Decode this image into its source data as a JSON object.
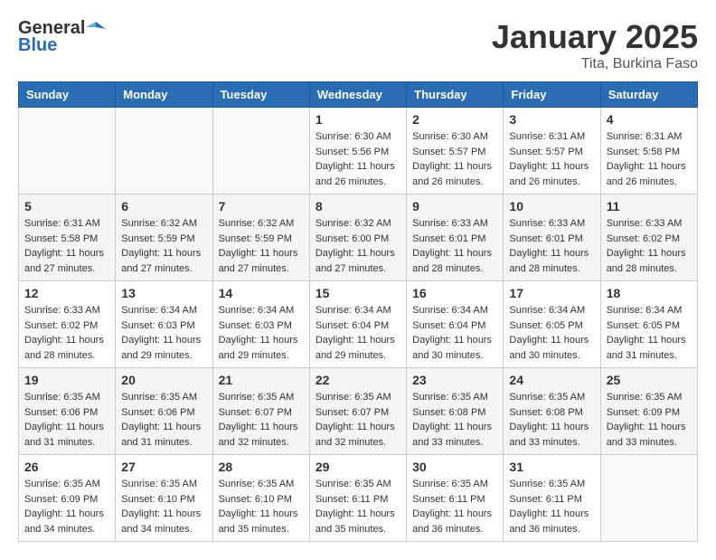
{
  "logo": {
    "general": "General",
    "blue": "Blue"
  },
  "header": {
    "month": "January 2025",
    "location": "Tita, Burkina Faso"
  },
  "weekdays": [
    "Sunday",
    "Monday",
    "Tuesday",
    "Wednesday",
    "Thursday",
    "Friday",
    "Saturday"
  ],
  "weeks": [
    [
      {
        "day": "",
        "info": []
      },
      {
        "day": "",
        "info": []
      },
      {
        "day": "",
        "info": []
      },
      {
        "day": "1",
        "info": [
          "Sunrise: 6:30 AM",
          "Sunset: 5:56 PM",
          "Daylight: 11 hours and 26 minutes."
        ]
      },
      {
        "day": "2",
        "info": [
          "Sunrise: 6:30 AM",
          "Sunset: 5:57 PM",
          "Daylight: 11 hours and 26 minutes."
        ]
      },
      {
        "day": "3",
        "info": [
          "Sunrise: 6:31 AM",
          "Sunset: 5:57 PM",
          "Daylight: 11 hours and 26 minutes."
        ]
      },
      {
        "day": "4",
        "info": [
          "Sunrise: 6:31 AM",
          "Sunset: 5:58 PM",
          "Daylight: 11 hours and 26 minutes."
        ]
      }
    ],
    [
      {
        "day": "5",
        "info": [
          "Sunrise: 6:31 AM",
          "Sunset: 5:58 PM",
          "Daylight: 11 hours and 27 minutes."
        ]
      },
      {
        "day": "6",
        "info": [
          "Sunrise: 6:32 AM",
          "Sunset: 5:59 PM",
          "Daylight: 11 hours and 27 minutes."
        ]
      },
      {
        "day": "7",
        "info": [
          "Sunrise: 6:32 AM",
          "Sunset: 5:59 PM",
          "Daylight: 11 hours and 27 minutes."
        ]
      },
      {
        "day": "8",
        "info": [
          "Sunrise: 6:32 AM",
          "Sunset: 6:00 PM",
          "Daylight: 11 hours and 27 minutes."
        ]
      },
      {
        "day": "9",
        "info": [
          "Sunrise: 6:33 AM",
          "Sunset: 6:01 PM",
          "Daylight: 11 hours and 28 minutes."
        ]
      },
      {
        "day": "10",
        "info": [
          "Sunrise: 6:33 AM",
          "Sunset: 6:01 PM",
          "Daylight: 11 hours and 28 minutes."
        ]
      },
      {
        "day": "11",
        "info": [
          "Sunrise: 6:33 AM",
          "Sunset: 6:02 PM",
          "Daylight: 11 hours and 28 minutes."
        ]
      }
    ],
    [
      {
        "day": "12",
        "info": [
          "Sunrise: 6:33 AM",
          "Sunset: 6:02 PM",
          "Daylight: 11 hours and 28 minutes."
        ]
      },
      {
        "day": "13",
        "info": [
          "Sunrise: 6:34 AM",
          "Sunset: 6:03 PM",
          "Daylight: 11 hours and 29 minutes."
        ]
      },
      {
        "day": "14",
        "info": [
          "Sunrise: 6:34 AM",
          "Sunset: 6:03 PM",
          "Daylight: 11 hours and 29 minutes."
        ]
      },
      {
        "day": "15",
        "info": [
          "Sunrise: 6:34 AM",
          "Sunset: 6:04 PM",
          "Daylight: 11 hours and 29 minutes."
        ]
      },
      {
        "day": "16",
        "info": [
          "Sunrise: 6:34 AM",
          "Sunset: 6:04 PM",
          "Daylight: 11 hours and 30 minutes."
        ]
      },
      {
        "day": "17",
        "info": [
          "Sunrise: 6:34 AM",
          "Sunset: 6:05 PM",
          "Daylight: 11 hours and 30 minutes."
        ]
      },
      {
        "day": "18",
        "info": [
          "Sunrise: 6:34 AM",
          "Sunset: 6:05 PM",
          "Daylight: 11 hours and 31 minutes."
        ]
      }
    ],
    [
      {
        "day": "19",
        "info": [
          "Sunrise: 6:35 AM",
          "Sunset: 6:06 PM",
          "Daylight: 11 hours and 31 minutes."
        ]
      },
      {
        "day": "20",
        "info": [
          "Sunrise: 6:35 AM",
          "Sunset: 6:06 PM",
          "Daylight: 11 hours and 31 minutes."
        ]
      },
      {
        "day": "21",
        "info": [
          "Sunrise: 6:35 AM",
          "Sunset: 6:07 PM",
          "Daylight: 11 hours and 32 minutes."
        ]
      },
      {
        "day": "22",
        "info": [
          "Sunrise: 6:35 AM",
          "Sunset: 6:07 PM",
          "Daylight: 11 hours and 32 minutes."
        ]
      },
      {
        "day": "23",
        "info": [
          "Sunrise: 6:35 AM",
          "Sunset: 6:08 PM",
          "Daylight: 11 hours and 33 minutes."
        ]
      },
      {
        "day": "24",
        "info": [
          "Sunrise: 6:35 AM",
          "Sunset: 6:08 PM",
          "Daylight: 11 hours and 33 minutes."
        ]
      },
      {
        "day": "25",
        "info": [
          "Sunrise: 6:35 AM",
          "Sunset: 6:09 PM",
          "Daylight: 11 hours and 33 minutes."
        ]
      }
    ],
    [
      {
        "day": "26",
        "info": [
          "Sunrise: 6:35 AM",
          "Sunset: 6:09 PM",
          "Daylight: 11 hours and 34 minutes."
        ]
      },
      {
        "day": "27",
        "info": [
          "Sunrise: 6:35 AM",
          "Sunset: 6:10 PM",
          "Daylight: 11 hours and 34 minutes."
        ]
      },
      {
        "day": "28",
        "info": [
          "Sunrise: 6:35 AM",
          "Sunset: 6:10 PM",
          "Daylight: 11 hours and 35 minutes."
        ]
      },
      {
        "day": "29",
        "info": [
          "Sunrise: 6:35 AM",
          "Sunset: 6:11 PM",
          "Daylight: 11 hours and 35 minutes."
        ]
      },
      {
        "day": "30",
        "info": [
          "Sunrise: 6:35 AM",
          "Sunset: 6:11 PM",
          "Daylight: 11 hours and 36 minutes."
        ]
      },
      {
        "day": "31",
        "info": [
          "Sunrise: 6:35 AM",
          "Sunset: 6:11 PM",
          "Daylight: 11 hours and 36 minutes."
        ]
      },
      {
        "day": "",
        "info": []
      }
    ]
  ]
}
